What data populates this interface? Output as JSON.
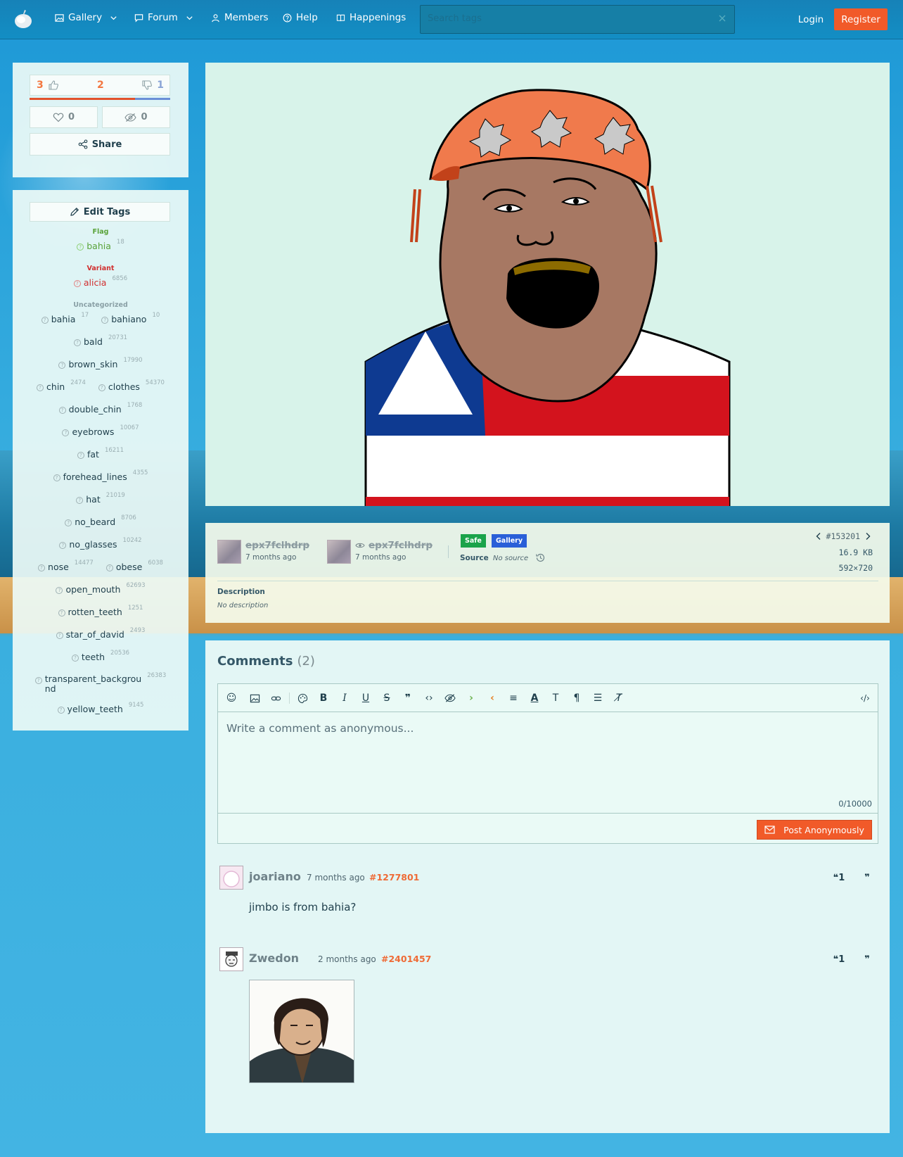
{
  "nav": {
    "items": [
      {
        "label": "Gallery",
        "icon": "image-icon",
        "dropdown": true
      },
      {
        "label": "Forum",
        "icon": "chat-icon",
        "dropdown": true
      },
      {
        "label": "Members",
        "icon": "user-icon",
        "dropdown": false
      },
      {
        "label": "Help",
        "icon": "question-icon",
        "dropdown": false
      },
      {
        "label": "Happenings",
        "icon": "book-icon",
        "dropdown": false
      }
    ],
    "search_placeholder": "Search tags",
    "login": "Login",
    "register": "Register"
  },
  "votes": {
    "up": "3",
    "score": "2",
    "down": "1",
    "up_fraction": 0.75,
    "favorites": "0",
    "hides": "0",
    "share": "Share"
  },
  "tags": {
    "edit_label": "Edit Tags",
    "categories": [
      {
        "name": "Flag",
        "color": "#5aa33a",
        "rows": [
          [
            {
              "name": "bahia",
              "count": "18"
            }
          ]
        ]
      },
      {
        "name": "Variant",
        "color": "#d12f2f",
        "rows": [
          [
            {
              "name": "alicia",
              "count": "6856"
            }
          ]
        ]
      },
      {
        "name": "Uncategorized",
        "color": "#8aa0a6",
        "rows": [
          [
            {
              "name": "bahia",
              "count": "17"
            },
            {
              "name": "bahiano",
              "count": "10"
            }
          ],
          [
            {
              "name": "bald",
              "count": "20731"
            }
          ],
          [
            {
              "name": "brown_skin",
              "count": "17990"
            }
          ],
          [
            {
              "name": "chin",
              "count": "2474"
            },
            {
              "name": "clothes",
              "count": "54370"
            }
          ],
          [
            {
              "name": "double_chin",
              "count": "1768"
            }
          ],
          [
            {
              "name": "eyebrows",
              "count": "10067"
            }
          ],
          [
            {
              "name": "fat",
              "count": "16211"
            }
          ],
          [
            {
              "name": "forehead_lines",
              "count": "4355"
            }
          ],
          [
            {
              "name": "hat",
              "count": "21019"
            }
          ],
          [
            {
              "name": "no_beard",
              "count": "8706"
            }
          ],
          [
            {
              "name": "no_glasses",
              "count": "10242"
            }
          ],
          [
            {
              "name": "nose",
              "count": "14477"
            },
            {
              "name": "obese",
              "count": "6038"
            }
          ],
          [
            {
              "name": "open_mouth",
              "count": "62693"
            }
          ],
          [
            {
              "name": "rotten_teeth",
              "count": "1251"
            }
          ],
          [
            {
              "name": "star_of_david",
              "count": "2493"
            }
          ],
          [
            {
              "name": "teeth",
              "count": "20536"
            }
          ],
          [
            {
              "name": "transparent_backgrou\nnd",
              "count": "26383"
            }
          ],
          [
            {
              "name": "yellow_teeth",
              "count": "9145"
            }
          ]
        ]
      }
    ]
  },
  "info": {
    "uploader_name": "epx7fclhdrp",
    "uploader_time": "7 months ago",
    "editor_name": "epx7fclhdrp",
    "editor_time": "7 months ago",
    "badge_safe": "Safe",
    "badge_gallery": "Gallery",
    "badge_safe_color": "#1aa34a",
    "badge_gallery_color": "#2a5fd8",
    "source_label": "Source",
    "source_value": "No source",
    "post_id": "#153201",
    "file_size": "16.9 KB",
    "dimensions": "592×720",
    "description_label": "Description",
    "description_value": "No description"
  },
  "comments": {
    "title": "Comments",
    "count": "(2)",
    "placeholder": "Write a comment as anonymous...",
    "char_count": "0/10000",
    "post_label": "Post Anonymously",
    "list": [
      {
        "user": "joariano",
        "time": "7 months ago",
        "id": "#1277801",
        "text": "jimbo is from bahia?"
      },
      {
        "user": "Zwedon",
        "time": "2 months ago",
        "id": "#2401457",
        "text": ""
      }
    ]
  }
}
